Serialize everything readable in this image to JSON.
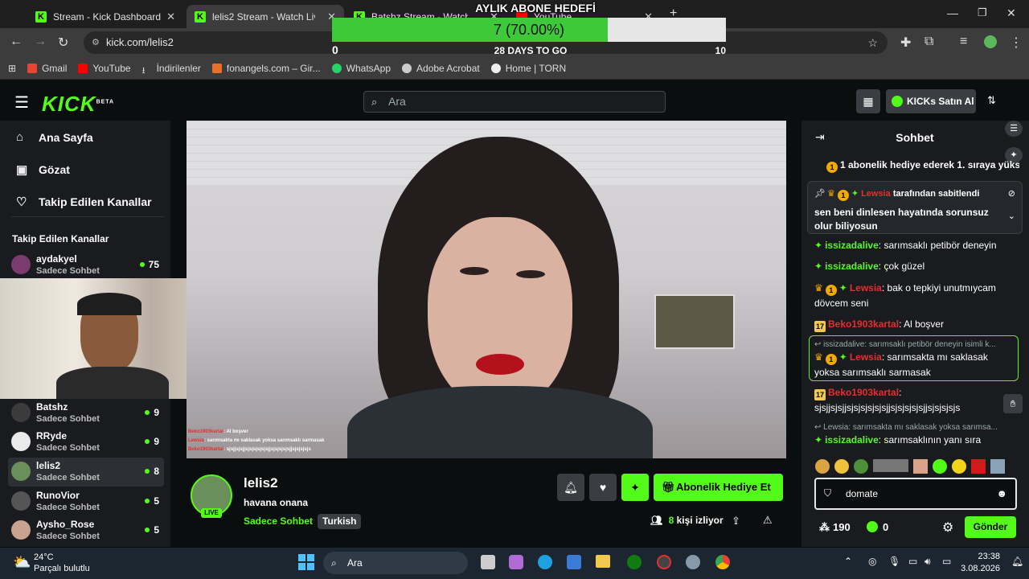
{
  "tabs": [
    {
      "title": "Stream - Kick Dashboard"
    },
    {
      "title": "lelis2 Stream - Watch Live o"
    },
    {
      "title": "Batshz Stream - Watch Live"
    },
    {
      "title": "YouTube"
    }
  ],
  "url": "kick.com/lelis2",
  "bookmarks": [
    "Gmail",
    "YouTube",
    "İndirilenler",
    "fonangels.com – Gir...",
    "WhatsApp",
    "Adobe Acrobat",
    "Home | TORN"
  ],
  "overlay": {
    "title": "AYLIK ABONE HEDEFİ",
    "progress_text": "7 (70.00%)",
    "progress": 0.7,
    "min": "0",
    "max": "10",
    "days": "28 DAYS TO GO"
  },
  "header": {
    "logo": "KICK",
    "beta": "BETA",
    "search_placeholder": "Ara",
    "buy_kicks": "KICKs Satın Al"
  },
  "sidebar": {
    "nav": [
      "Ana Sayfa",
      "Gözat",
      "Takip Edilen Kanallar"
    ],
    "section_title": "Takip Edilen Kanallar",
    "channels": [
      {
        "name": "aydakyel",
        "category": "Sadece Sohbet",
        "viewers": "75"
      },
      {
        "name": "Batshz",
        "category": "Sadece Sohbet",
        "viewers": "9"
      },
      {
        "name": "RRyde",
        "category": "Sadece Sohbet",
        "viewers": "9"
      },
      {
        "name": "lelis2",
        "category": "Sadece Sohbet",
        "viewers": "8"
      },
      {
        "name": "RunoVior",
        "category": "Sadece Sohbet",
        "viewers": "5"
      },
      {
        "name": "Aysho_Rose",
        "category": "Sadece Sohbet",
        "viewers": "5"
      }
    ]
  },
  "stream_overlay_chat": [
    {
      "user": "Beko1903kartal",
      "text": ": Al boşver"
    },
    {
      "user": "Lewsia",
      "text": ": sarımsakta mı saklasak yoksa sarımsaklı sarmasak"
    },
    {
      "user": "Beko1903kartal",
      "text": ": sjsjjsjsjjsjsjsjsjsjsjjsjsjsjsjsjjsjsjsjsjs"
    }
  ],
  "channel": {
    "name": "lelis2",
    "title": "havana onana",
    "category": "Sadece Sohbet",
    "tag": "Turkish",
    "live": "LIVE",
    "viewers": "8",
    "viewers_label": "kişi izliyor",
    "gift_button": "Abonelik Hediye Et"
  },
  "chat": {
    "title": "Sohbet",
    "gift_banner": "1 abonelik hediye ederek 1. sıraya yüks",
    "pinned_by": "Lewsia",
    "pinned_suffix": "tarafından sabitlendi",
    "pinned_text": "sen beni dinlesen hayatında sorunsuz olur biliyosun",
    "messages": [
      {
        "user": "issizadalive",
        "text": ": sarımsaklı petibör deneyin"
      },
      {
        "user": "issizadalive",
        "text": ": çok güzel"
      },
      {
        "user": "Lewsia",
        "text": ": bak o tepkiyi unutmıycam dövcem seni"
      },
      {
        "user": "Beko1903kartal",
        "text": ": Al boşver"
      },
      {
        "reply": "issizadalive: sarımsaklı petibör deneyin isimli k...",
        "user": "Lewsia",
        "text": ": sarımsakta mı saklasak yoksa sarımsaklı sarmasak"
      },
      {
        "user": "Beko1903kartal",
        "text": ":",
        "text2": "sjsjjsjsjjsjsjsjsjsjsjjsjsjsjsjsjjsjsjsjsjs"
      },
      {
        "reply": "Lewsia: sarımsakta mı saklasak yoksa sarımsa...",
        "user": "issizadalive",
        "text": ": sarımsaklının yanı sıra"
      }
    ],
    "input_value": "domate",
    "points": "190",
    "kicks": "0",
    "send": "Gönder",
    "sub_badge": "17"
  },
  "taskbar": {
    "weather_temp": "24°C",
    "weather_desc": "Parçalı bulutlu",
    "search": "Ara",
    "time": "23:38",
    "date": "3.08.2026"
  }
}
